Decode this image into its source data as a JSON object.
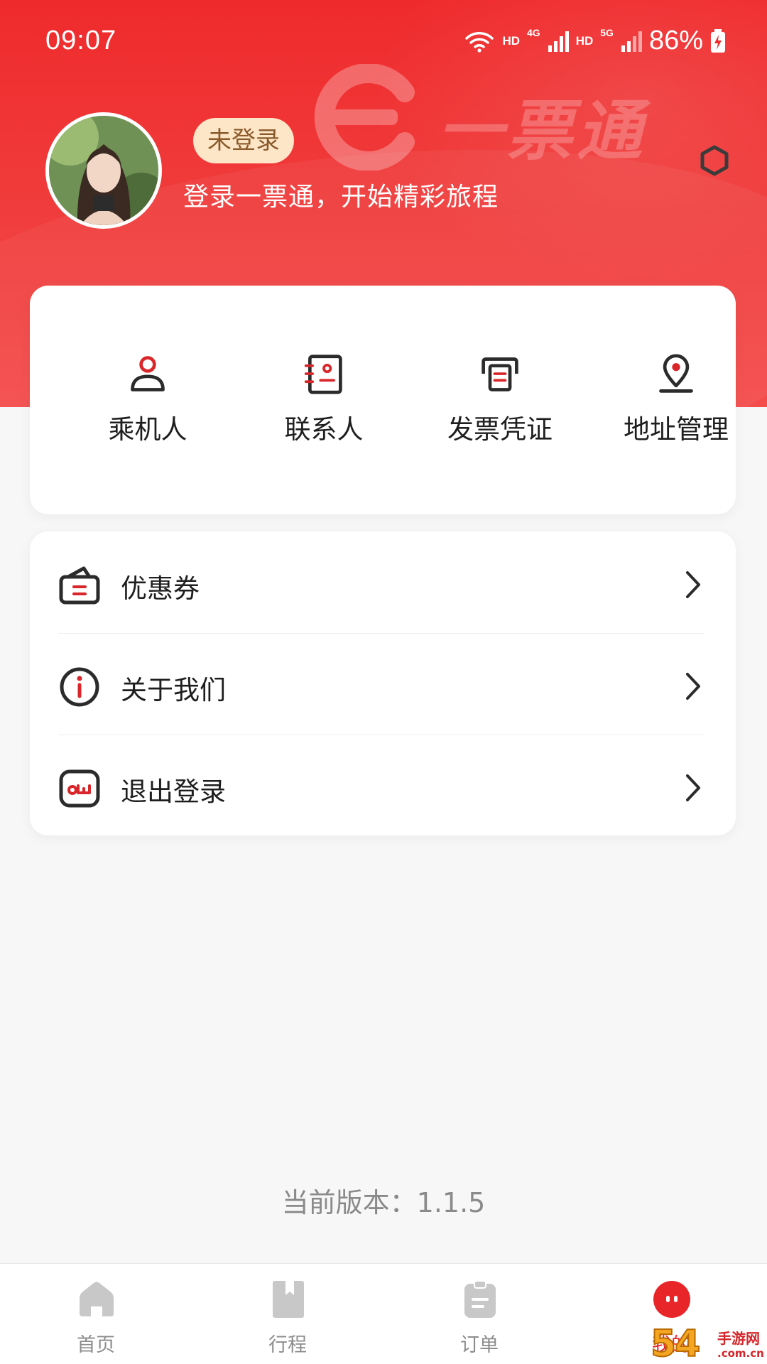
{
  "status_bar": {
    "time": "09:07",
    "hd_1": "HD",
    "net_1": "4G",
    "hd_2": "HD",
    "net_2": "5G",
    "battery": "86%"
  },
  "header": {
    "watermark_text": "一票通",
    "login_badge": "未登录",
    "login_hint": "登录一票通，开始精彩旅程",
    "colors": {
      "brand_red": "#ef2a2c",
      "badge_bg": "#fde6c8",
      "badge_text": "#8a5a2a"
    }
  },
  "quick_actions": [
    {
      "label": "乘机人",
      "icon": "passenger-icon"
    },
    {
      "label": "联系人",
      "icon": "contacts-book-icon"
    },
    {
      "label": "发票凭证",
      "icon": "invoice-printer-icon"
    },
    {
      "label": "地址管理",
      "icon": "location-pin-icon"
    }
  ],
  "menu": [
    {
      "label": "优惠券",
      "icon": "coupon-wallet-icon"
    },
    {
      "label": "关于我们",
      "icon": "info-circle-icon"
    },
    {
      "label": "退出登录",
      "icon": "logout-icon"
    }
  ],
  "version_text": "当前版本：1.1.5",
  "tabbar": {
    "tabs": [
      {
        "label": "首页",
        "icon": "home-icon",
        "active": false
      },
      {
        "label": "行程",
        "icon": "bookmark-icon",
        "active": false
      },
      {
        "label": "订单",
        "icon": "clipboard-icon",
        "active": false
      },
      {
        "label": "我的",
        "icon": "profile-face-icon",
        "active": true
      }
    ],
    "active_color": "#e8262a",
    "inactive_color": "#c8c8c8"
  },
  "site_watermark": {
    "number": "54",
    "name": "手游网",
    "domain": ".com.cn"
  }
}
